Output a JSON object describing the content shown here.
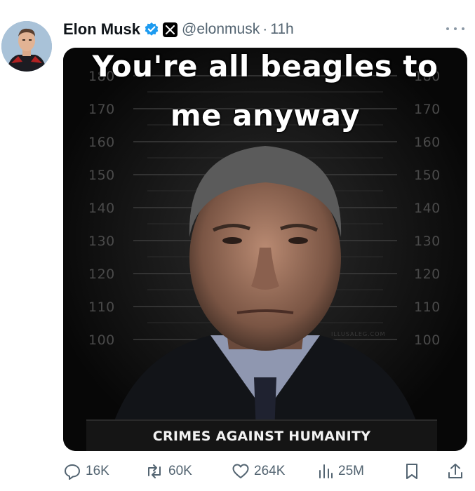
{
  "author": {
    "name": "Elon Musk",
    "handle": "@elonmusk",
    "separator": "·",
    "time": "11h"
  },
  "media": {
    "caption_line1": "You're all beagles to",
    "caption_line2": "me anyway",
    "bottom_label": "CRIMES AGAINST HUMANITY",
    "watermark": "ILLUSALEG.COM",
    "ruler_left": [
      "180",
      "170",
      "160",
      "150",
      "140",
      "130",
      "120",
      "110",
      "100"
    ],
    "ruler_right": [
      "180",
      "170",
      "160",
      "150",
      "140",
      "130",
      "120",
      "110",
      "100"
    ]
  },
  "actions": {
    "replies": "16K",
    "reposts": "60K",
    "likes": "264K",
    "views": "25M"
  },
  "colors": {
    "verified": "#1d9bf0",
    "muted_text": "#536471",
    "primary_text": "#0f1419"
  },
  "icons": {
    "verified": "verified-badge-icon",
    "affiliation": "x-logo-icon",
    "more": "more-dots-icon",
    "reply": "reply-icon",
    "repost": "repost-icon",
    "like": "heart-icon",
    "views": "views-chart-icon",
    "bookmark": "bookmark-icon",
    "share": "share-icon"
  }
}
